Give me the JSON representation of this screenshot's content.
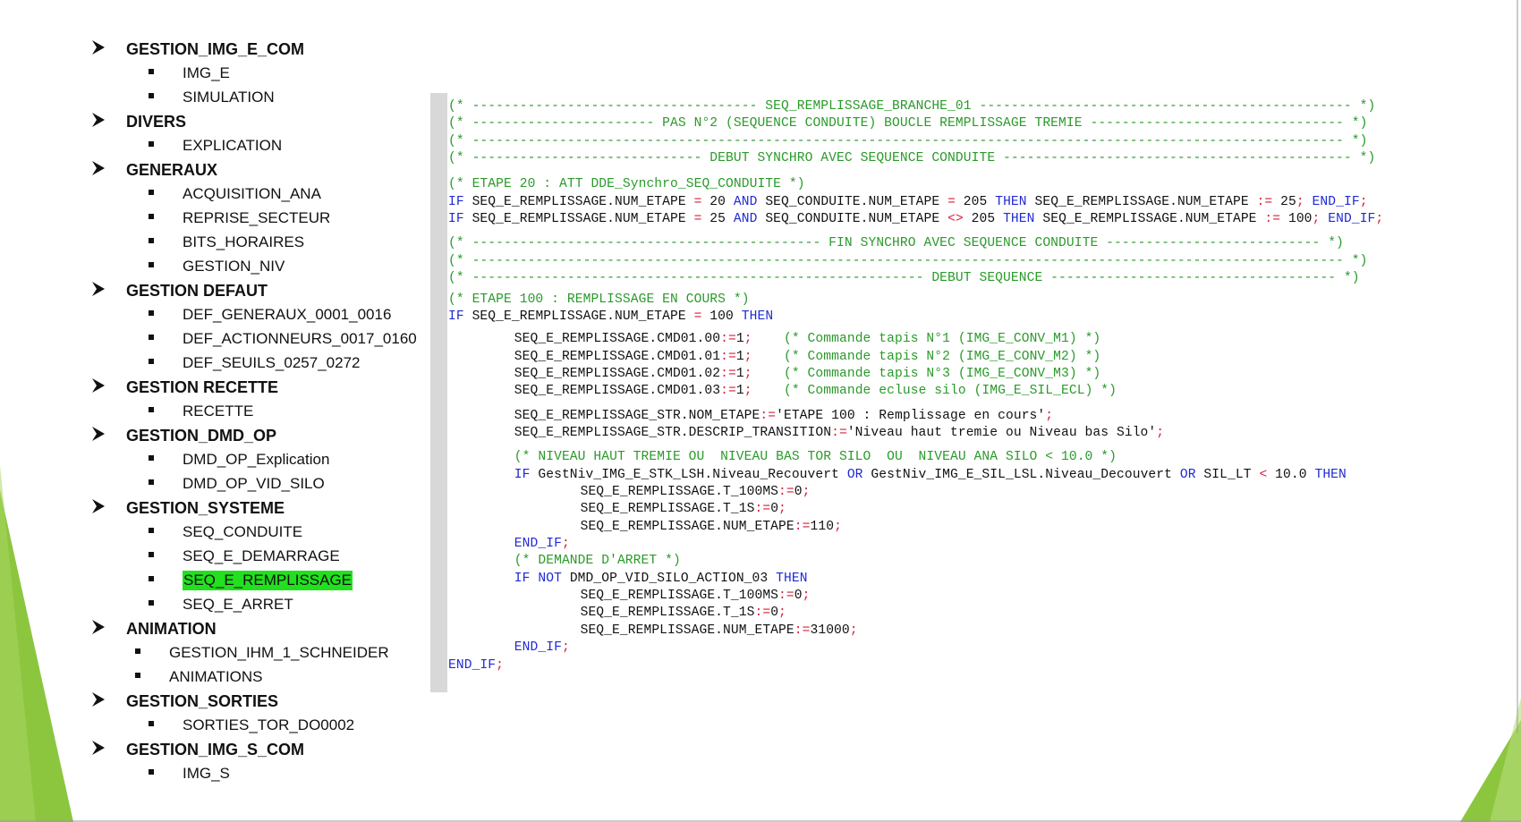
{
  "colors": {
    "highlight": "#22e01e",
    "comment": "#2a9a2a",
    "keyword": "#1f2ad4",
    "operator": "#d6203a",
    "decoration": "#8cc63f",
    "gutter": "#d8d8d8"
  },
  "outline": [
    {
      "level": 1,
      "label": "GESTION_IMG_E_COM",
      "icon": "arrow-bullet-icon"
    },
    {
      "level": 2,
      "label": "IMG_E",
      "icon": "square-bullet-icon"
    },
    {
      "level": 2,
      "label": "SIMULATION",
      "icon": "square-bullet-icon"
    },
    {
      "level": 1,
      "label": "DIVERS",
      "icon": "arrow-bullet-icon"
    },
    {
      "level": 2,
      "label": "EXPLICATION",
      "icon": "square-bullet-icon"
    },
    {
      "level": 1,
      "label": "GENERAUX",
      "icon": "arrow-bullet-icon"
    },
    {
      "level": 2,
      "label": "ACQUISITION_ANA",
      "icon": "square-bullet-icon"
    },
    {
      "level": 2,
      "label": "REPRISE_SECTEUR",
      "icon": "square-bullet-icon"
    },
    {
      "level": 2,
      "label": "BITS_HORAIRES",
      "icon": "square-bullet-icon"
    },
    {
      "level": 2,
      "label": "GESTION_NIV",
      "icon": "square-bullet-icon"
    },
    {
      "level": 1,
      "label": "GESTION DEFAUT",
      "icon": "arrow-bullet-icon"
    },
    {
      "level": 2,
      "label": "DEF_GENERAUX_0001_0016",
      "icon": "square-bullet-icon"
    },
    {
      "level": 2,
      "label": "DEF_ACTIONNEURS_0017_0160",
      "icon": "square-bullet-icon"
    },
    {
      "level": 2,
      "label": "DEF_SEUILS_0257_0272",
      "icon": "square-bullet-icon"
    },
    {
      "level": 1,
      "label": "GESTION RECETTE",
      "icon": "arrow-bullet-icon"
    },
    {
      "level": 2,
      "label": "RECETTE",
      "icon": "square-bullet-icon"
    },
    {
      "level": 1,
      "label": "GESTION_DMD_OP",
      "icon": "arrow-bullet-icon"
    },
    {
      "level": 2,
      "label": "DMD_OP_Explication",
      "icon": "square-bullet-icon"
    },
    {
      "level": 2,
      "label": "DMD_OP_VID_SILO",
      "icon": "square-bullet-icon"
    },
    {
      "level": 1,
      "label": "GESTION_SYSTEME",
      "icon": "arrow-bullet-icon"
    },
    {
      "level": 2,
      "label": "SEQ_CONDUITE",
      "icon": "square-bullet-icon"
    },
    {
      "level": 2,
      "label": "SEQ_E_DEMARRAGE",
      "icon": "square-bullet-icon"
    },
    {
      "level": 2,
      "label": "SEQ_E_REMPLISSAGE",
      "icon": "square-bullet-icon",
      "highlighted": true
    },
    {
      "level": 2,
      "label": "SEQ_E_ARRET",
      "icon": "square-bullet-icon"
    },
    {
      "level": 1,
      "label": "ANIMATION",
      "icon": "arrow-bullet-icon"
    },
    {
      "level": 2,
      "label": "GESTION_IHM_1_SCHNEIDER",
      "icon": "square-bullet-icon",
      "compact": true
    },
    {
      "level": 2,
      "label": "ANIMATIONS",
      "icon": "square-bullet-icon",
      "compact": true
    },
    {
      "level": 1,
      "label": "GESTION_SORTIES",
      "icon": "arrow-bullet-icon"
    },
    {
      "level": 2,
      "label": "SORTIES_TOR_DO0002",
      "icon": "square-bullet-icon"
    },
    {
      "level": 1,
      "label": "GESTION_IMG_S_COM",
      "icon": "arrow-bullet-icon"
    },
    {
      "level": 2,
      "label": "IMG_S",
      "icon": "square-bullet-icon"
    }
  ],
  "code": {
    "lines": [
      {
        "gap": 0,
        "indent": 0,
        "tokens": [
          [
            "cm",
            "(* ------------------------------------ SEQ_REMPLISSAGE_BRANCHE_01 ----------------------------------------------- *)"
          ]
        ]
      },
      {
        "gap": 0,
        "indent": 0,
        "tokens": [
          [
            "cm",
            "(* ----------------------- PAS N°2 (SEQUENCE CONDUITE) BOUCLE REMPLISSAGE TREMIE -------------------------------- *)"
          ]
        ]
      },
      {
        "gap": 0,
        "indent": 0,
        "tokens": [
          [
            "cm",
            "(* -------------------------------------------------------------------------------------------------------------- *)"
          ]
        ]
      },
      {
        "gap": 0,
        "indent": 0,
        "tokens": [
          [
            "cm",
            "(* ----------------------------- DEBUT SYNCHRO AVEC SEQUENCE CONDUITE -------------------------------------------- *)"
          ]
        ]
      },
      {
        "gap": 10,
        "indent": 0,
        "tokens": [
          [
            "cm",
            "(* ETAPE 20 : ATT DDE_Synchro_SEQ_CONDUITE *)"
          ]
        ]
      },
      {
        "gap": 0,
        "indent": 0,
        "tokens": [
          [
            "kw",
            "IF "
          ],
          [
            "tx",
            "SEQ_E_REMPLISSAGE.NUM_ETAPE "
          ],
          [
            "op",
            "="
          ],
          [
            "tx",
            " 20 "
          ],
          [
            "kw",
            "AND"
          ],
          [
            "tx",
            " SEQ_CONDUITE.NUM_ETAPE "
          ],
          [
            "op",
            "="
          ],
          [
            "tx",
            " 205 "
          ],
          [
            "kw",
            "THEN"
          ],
          [
            "tx",
            " SEQ_E_REMPLISSAGE.NUM_ETAPE "
          ],
          [
            "op",
            ":="
          ],
          [
            "tx",
            " 25"
          ],
          [
            "op",
            ";"
          ],
          [
            "tx",
            " "
          ],
          [
            "kw",
            "END_IF"
          ],
          [
            "op",
            ";"
          ]
        ]
      },
      {
        "gap": 0,
        "indent": 0,
        "tokens": [
          [
            "kw",
            "IF "
          ],
          [
            "tx",
            "SEQ_E_REMPLISSAGE.NUM_ETAPE "
          ],
          [
            "op",
            "="
          ],
          [
            "tx",
            " 25 "
          ],
          [
            "kw",
            "AND"
          ],
          [
            "tx",
            " SEQ_CONDUITE.NUM_ETAPE "
          ],
          [
            "op",
            "<>"
          ],
          [
            "tx",
            " 205 "
          ],
          [
            "kw",
            "THEN"
          ],
          [
            "tx",
            " SEQ_E_REMPLISSAGE.NUM_ETAPE "
          ],
          [
            "op",
            ":="
          ],
          [
            "tx",
            " 100"
          ],
          [
            "op",
            ";"
          ],
          [
            "tx",
            " "
          ],
          [
            "kw",
            "END_IF"
          ],
          [
            "op",
            ";"
          ]
        ]
      },
      {
        "gap": 8,
        "indent": 0,
        "tokens": [
          [
            "cm",
            "(* -------------------------------------------- FIN SYNCHRO AVEC SEQUENCE CONDUITE --------------------------- *)"
          ]
        ]
      },
      {
        "gap": 0,
        "indent": 0,
        "tokens": [
          [
            "cm",
            "(* -------------------------------------------------------------------------------------------------------------- *)"
          ]
        ]
      },
      {
        "gap": 0,
        "indent": 0,
        "tokens": [
          [
            "cm",
            "(* --------------------------------------------------------- DEBUT SEQUENCE ------------------------------------ *)"
          ]
        ]
      },
      {
        "gap": 4,
        "indent": 0,
        "tokens": [
          [
            "cm",
            "(* ETAPE 100 : REMPLISSAGE EN COURS *)"
          ]
        ]
      },
      {
        "gap": 0,
        "indent": 0,
        "tokens": [
          [
            "kw",
            "IF "
          ],
          [
            "tx",
            "SEQ_E_REMPLISSAGE.NUM_ETAPE "
          ],
          [
            "op",
            "="
          ],
          [
            "tx",
            " 100 "
          ],
          [
            "kw",
            "THEN"
          ]
        ]
      },
      {
        "gap": 6,
        "indent": 9,
        "tokens": [
          [
            "tx",
            "SEQ_E_REMPLISSAGE.CMD01.00"
          ],
          [
            "op",
            ":="
          ],
          [
            "tx",
            "1"
          ],
          [
            "op",
            ";"
          ],
          [
            "tx",
            "    "
          ],
          [
            "cm",
            "(* Commande tapis N°1 (IMG_E_CONV_M1) *)"
          ]
        ]
      },
      {
        "gap": 0,
        "indent": 9,
        "tokens": [
          [
            "tx",
            "SEQ_E_REMPLISSAGE.CMD01.01"
          ],
          [
            "op",
            ":="
          ],
          [
            "tx",
            "1"
          ],
          [
            "op",
            ";"
          ],
          [
            "tx",
            "    "
          ],
          [
            "cm",
            "(* Commande tapis N°2 (IMG_E_CONV_M2) *)"
          ]
        ]
      },
      {
        "gap": 0,
        "indent": 9,
        "tokens": [
          [
            "tx",
            "SEQ_E_REMPLISSAGE.CMD01.02"
          ],
          [
            "op",
            ":="
          ],
          [
            "tx",
            "1"
          ],
          [
            "op",
            ";"
          ],
          [
            "tx",
            "    "
          ],
          [
            "cm",
            "(* Commande tapis N°3 (IMG_E_CONV_M3) *)"
          ]
        ]
      },
      {
        "gap": 0,
        "indent": 9,
        "tokens": [
          [
            "tx",
            "SEQ_E_REMPLISSAGE.CMD01.03"
          ],
          [
            "op",
            ":="
          ],
          [
            "tx",
            "1"
          ],
          [
            "op",
            ";"
          ],
          [
            "tx",
            "    "
          ],
          [
            "cm",
            "(* Commande ecluse silo (IMG_E_SIL_ECL) *)"
          ]
        ]
      },
      {
        "gap": 8,
        "indent": 9,
        "tokens": [
          [
            "tx",
            "SEQ_E_REMPLISSAGE_STR.NOM_ETAPE"
          ],
          [
            "op",
            ":="
          ],
          [
            "tx",
            "'ETAPE 100 : Remplissage en cours'"
          ],
          [
            "op",
            ";"
          ]
        ]
      },
      {
        "gap": 0,
        "indent": 9,
        "tokens": [
          [
            "tx",
            "SEQ_E_REMPLISSAGE_STR.DESCRIP_TRANSITION"
          ],
          [
            "op",
            ":="
          ],
          [
            "tx",
            "'Niveau haut tremie ou Niveau bas Silo'"
          ],
          [
            "op",
            ";"
          ]
        ]
      },
      {
        "gap": 8,
        "indent": 9,
        "tokens": [
          [
            "cm",
            "(* NIVEAU HAUT TREMIE OU  NIVEAU BAS TOR SILO  OU  NIVEAU ANA SILO < 10.0 *)"
          ]
        ]
      },
      {
        "gap": 0,
        "indent": 9,
        "tokens": [
          [
            "kw",
            "IF "
          ],
          [
            "tx",
            "GestNiv_IMG_E_STK_LSH.Niveau_Recouvert "
          ],
          [
            "kw",
            "OR"
          ],
          [
            "tx",
            " GestNiv_IMG_E_SIL_LSL.Niveau_Decouvert "
          ],
          [
            "kw",
            "OR"
          ],
          [
            "tx",
            " SIL_LT "
          ],
          [
            "op",
            "<"
          ],
          [
            "tx",
            " 10.0 "
          ],
          [
            "kw",
            "THEN"
          ]
        ]
      },
      {
        "gap": 0,
        "indent": 18,
        "tokens": [
          [
            "tx",
            "SEQ_E_REMPLISSAGE.T_100MS"
          ],
          [
            "op",
            ":="
          ],
          [
            "tx",
            "0"
          ],
          [
            "op",
            ";"
          ]
        ]
      },
      {
        "gap": 0,
        "indent": 18,
        "tokens": [
          [
            "tx",
            "SEQ_E_REMPLISSAGE.T_1S"
          ],
          [
            "op",
            ":="
          ],
          [
            "tx",
            "0"
          ],
          [
            "op",
            ";"
          ]
        ]
      },
      {
        "gap": 0,
        "indent": 18,
        "tokens": [
          [
            "tx",
            "SEQ_E_REMPLISSAGE.NUM_ETAPE"
          ],
          [
            "op",
            ":="
          ],
          [
            "tx",
            "110"
          ],
          [
            "op",
            ";"
          ]
        ]
      },
      {
        "gap": 0,
        "indent": 9,
        "tokens": [
          [
            "kw",
            "END_IF"
          ],
          [
            "op",
            ";"
          ]
        ]
      },
      {
        "gap": 0,
        "indent": 9,
        "tokens": [
          [
            "cm",
            "(* DEMANDE D'ARRET *)"
          ]
        ]
      },
      {
        "gap": 0,
        "indent": 9,
        "tokens": [
          [
            "kw",
            "IF NOT "
          ],
          [
            "tx",
            "DMD_OP_VID_SILO_ACTION_03 "
          ],
          [
            "kw",
            "THEN"
          ]
        ]
      },
      {
        "gap": 0,
        "indent": 18,
        "tokens": [
          [
            "tx",
            "SEQ_E_REMPLISSAGE.T_100MS"
          ],
          [
            "op",
            ":="
          ],
          [
            "tx",
            "0"
          ],
          [
            "op",
            ";"
          ]
        ]
      },
      {
        "gap": 0,
        "indent": 18,
        "tokens": [
          [
            "tx",
            "SEQ_E_REMPLISSAGE.T_1S"
          ],
          [
            "op",
            ":="
          ],
          [
            "tx",
            "0"
          ],
          [
            "op",
            ";"
          ]
        ]
      },
      {
        "gap": 0,
        "indent": 18,
        "tokens": [
          [
            "tx",
            "SEQ_E_REMPLISSAGE.NUM_ETAPE"
          ],
          [
            "op",
            ":="
          ],
          [
            "tx",
            "31000"
          ],
          [
            "op",
            ";"
          ]
        ]
      },
      {
        "gap": 0,
        "indent": 9,
        "tokens": [
          [
            "kw",
            "END_IF"
          ],
          [
            "op",
            ";"
          ]
        ]
      },
      {
        "gap": 0,
        "indent": 0,
        "tokens": [
          [
            "kw",
            "END_IF"
          ],
          [
            "op",
            ";"
          ]
        ]
      }
    ]
  }
}
